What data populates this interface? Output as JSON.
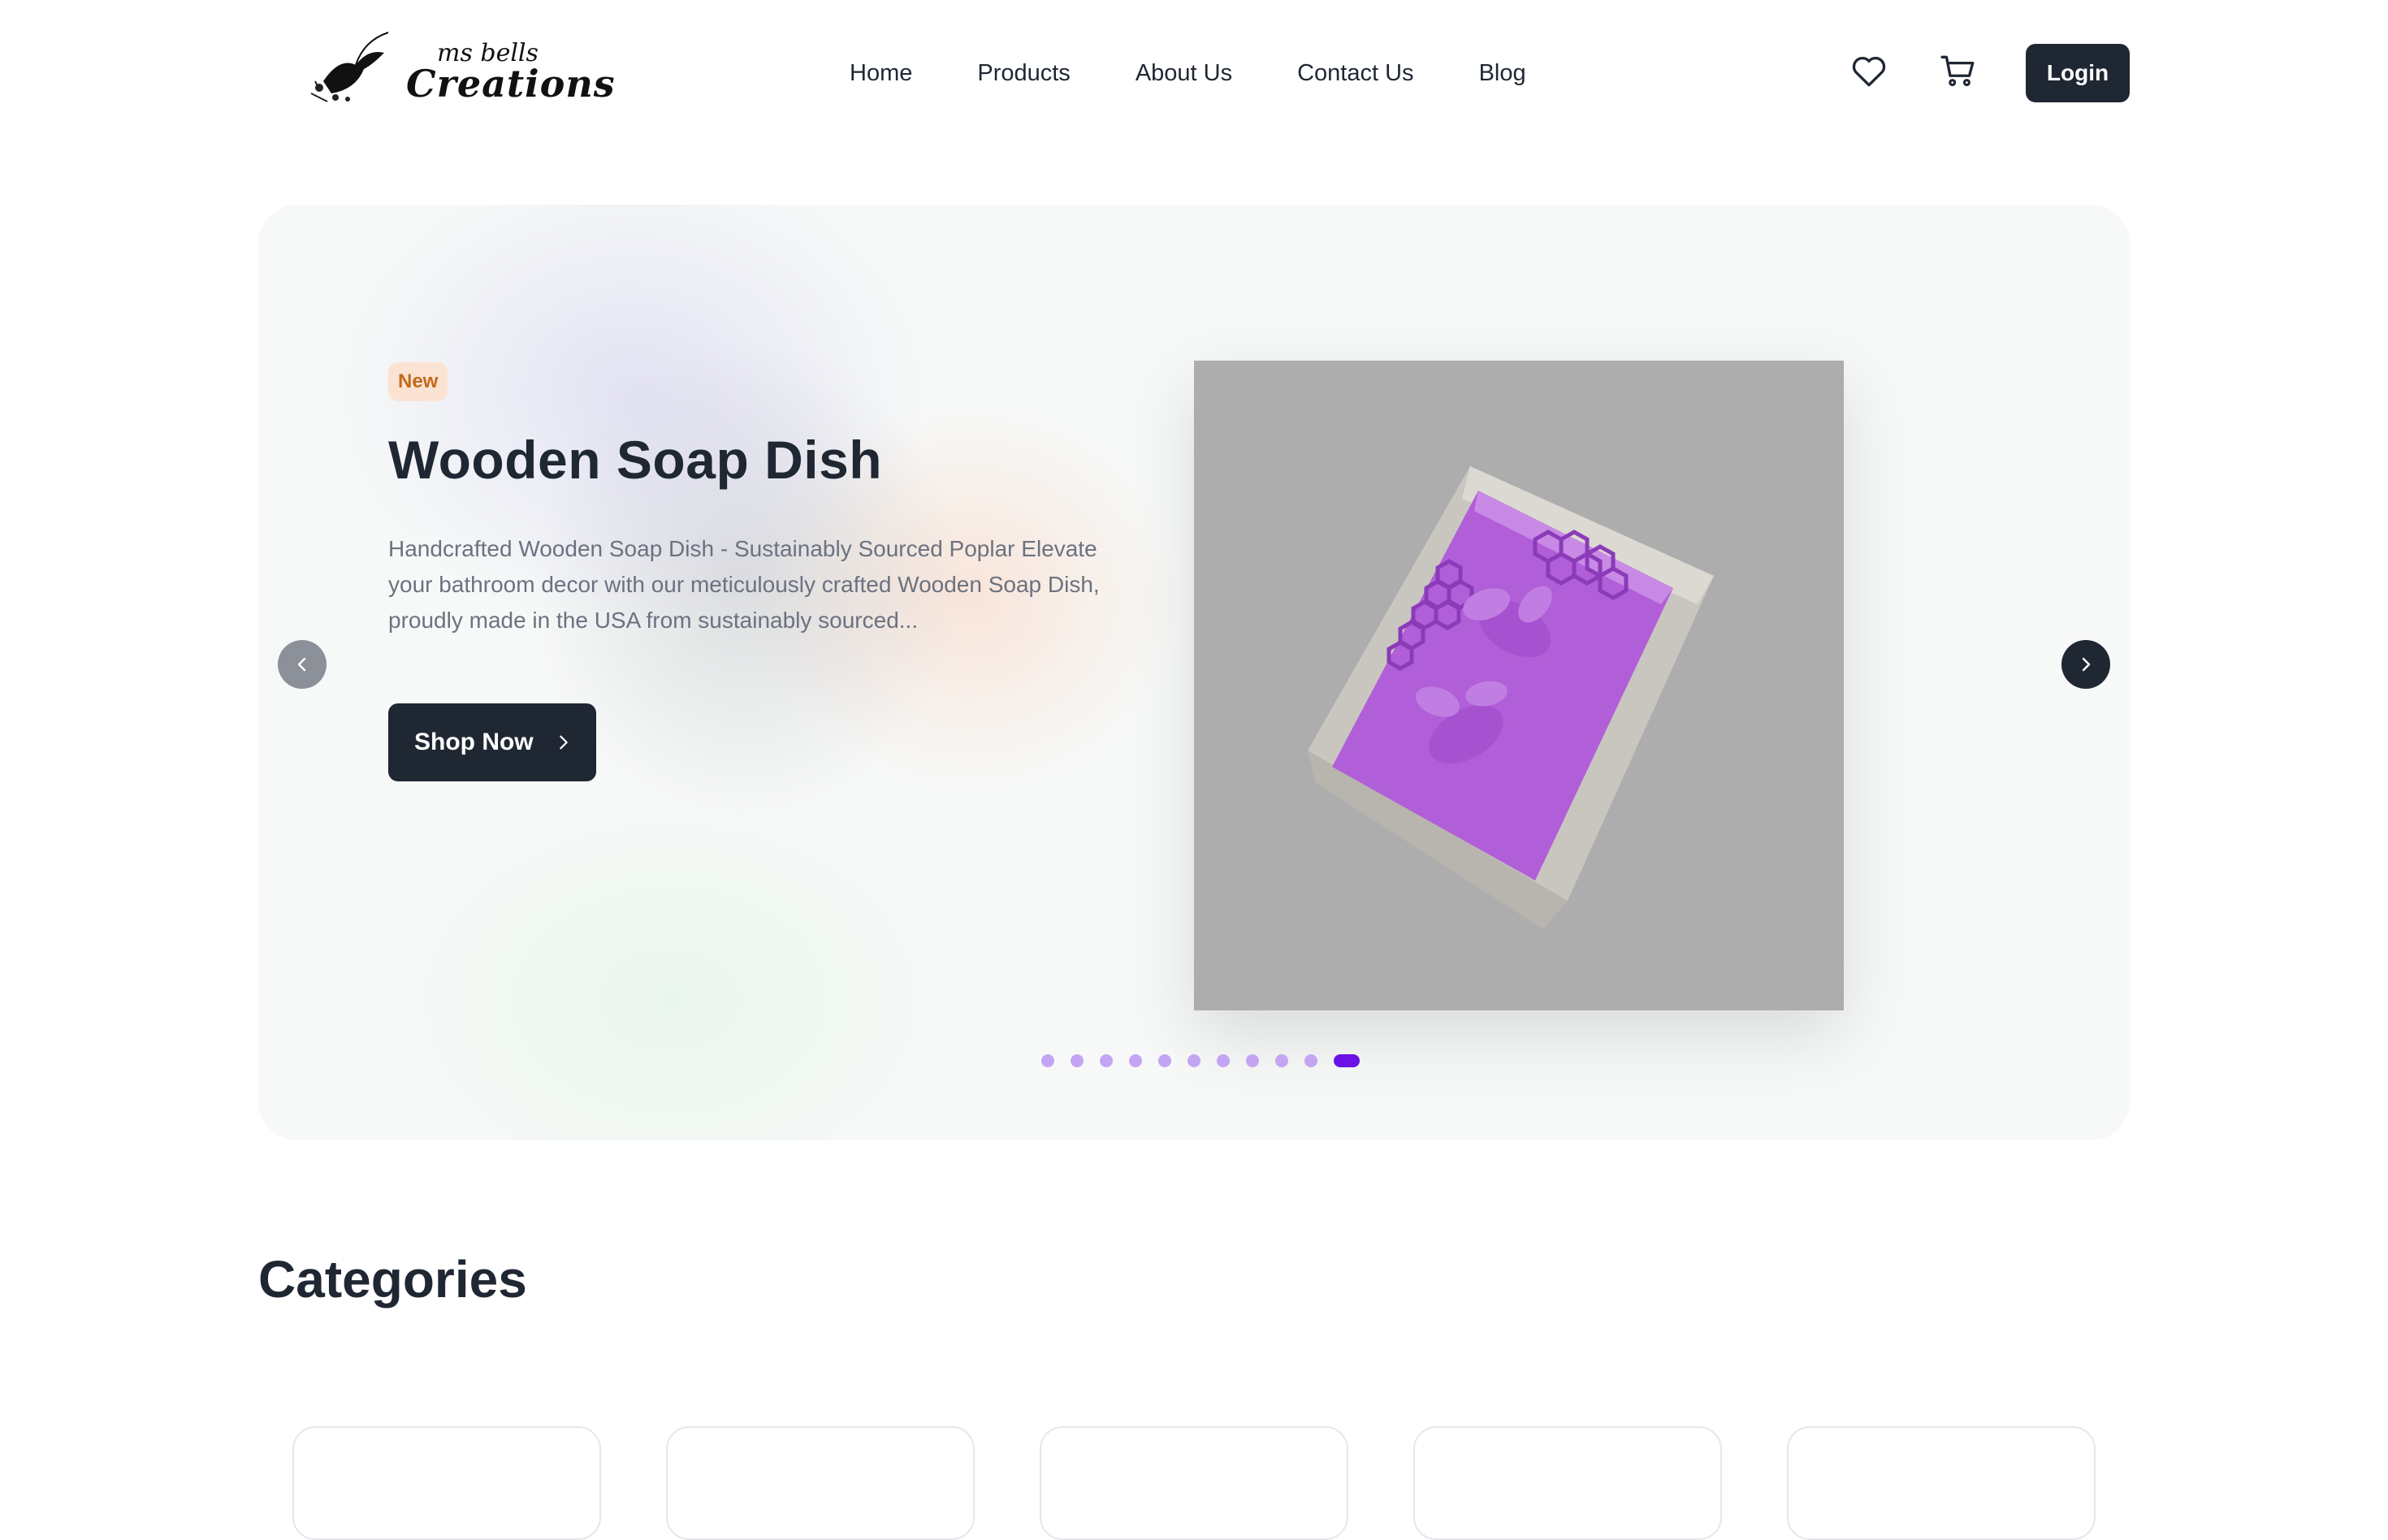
{
  "header": {
    "logo": {
      "top_text": "ms bells",
      "main_text": "Creations"
    },
    "nav": [
      "Home",
      "Products",
      "About Us",
      "Contact Us",
      "Blog"
    ],
    "icons": [
      "heart-icon",
      "cart-icon"
    ],
    "login_label": "Login"
  },
  "hero": {
    "badge": "New",
    "title": "Wooden Soap Dish",
    "description": "Handcrafted Wooden Soap Dish - Sustainably Sourced Poplar Elevate your bathroom decor with our meticulously crafted Wooden Soap Dish, proudly made in the USA from sustainably sourced...",
    "cta_label": "Shop Now",
    "slides_total": 11,
    "active_slide": 11,
    "colors": {
      "accent": "#6b12e6",
      "dot": "#c4a5f3",
      "dark": "#1f2733",
      "badge_bg": "#fbe3d3",
      "badge_text": "#c26a1a"
    }
  },
  "categories": {
    "title": "Categories",
    "card_count": 5
  }
}
